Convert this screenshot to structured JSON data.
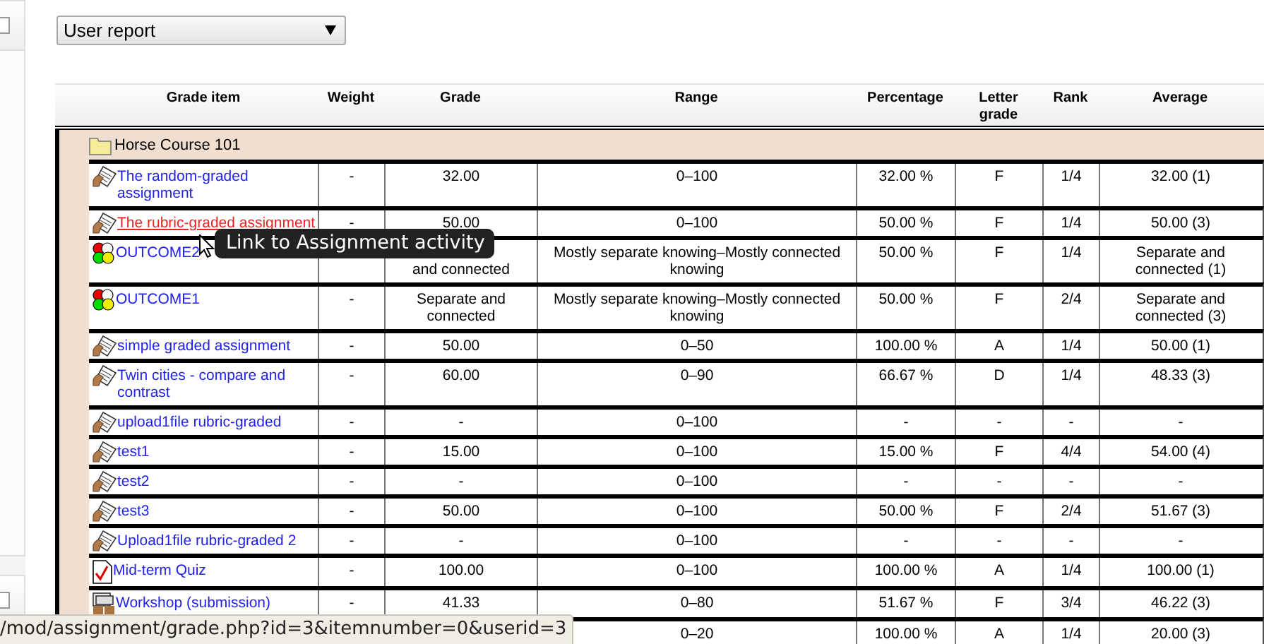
{
  "report_select": {
    "value": "User report"
  },
  "table": {
    "columns": [
      "Grade item",
      "Weight",
      "Grade",
      "Range",
      "Percentage",
      "Letter grade",
      "Rank",
      "Average"
    ],
    "category": {
      "kind": "folder",
      "name": "Horse Course 101"
    },
    "rows": [
      {
        "kind": "assignment",
        "item": "The random-graded assignment",
        "hovered": false,
        "weight": "-",
        "grade": "32.00",
        "range": "0–100",
        "percentage": "32.00 %",
        "letter": "F",
        "rank": "1/4",
        "average": "32.00 (1)"
      },
      {
        "kind": "assignment",
        "item": "The rubric-graded assignment",
        "hovered": true,
        "weight": "-",
        "grade": "50.00",
        "range": "0–100",
        "percentage": "50.00 %",
        "letter": "F",
        "rank": "1/4",
        "average": "50.00 (3)"
      },
      {
        "kind": "outcome",
        "item": "OUTCOME2",
        "hovered": false,
        "grade": "and connected",
        "range": "Mostly separate knowing–Mostly connected knowing",
        "percentage": "50.00 %",
        "letter": "F",
        "rank": "1/4",
        "average": "Separate and connected (1)"
      },
      {
        "kind": "outcome",
        "item": "OUTCOME1",
        "hovered": false,
        "weight": "-",
        "grade": "Separate and connected",
        "range": "Mostly separate knowing–Mostly connected knowing",
        "percentage": "50.00 %",
        "letter": "F",
        "rank": "2/4",
        "average": "Separate and connected (3)"
      },
      {
        "kind": "assignment",
        "item": "simple graded assignment",
        "hovered": false,
        "weight": "-",
        "grade": "50.00",
        "range": "0–50",
        "percentage": "100.00 %",
        "letter": "A",
        "rank": "1/4",
        "average": "50.00 (1)"
      },
      {
        "kind": "assignment",
        "item": "Twin cities - compare and contrast",
        "hovered": false,
        "weight": "-",
        "grade": "60.00",
        "range": "0–90",
        "percentage": "66.67 %",
        "letter": "D",
        "rank": "1/4",
        "average": "48.33 (3)"
      },
      {
        "kind": "assignment",
        "item": "upload1file rubric-graded",
        "hovered": false,
        "weight": "-",
        "grade": "-",
        "range": "0–100",
        "percentage": "-",
        "letter": "-",
        "rank": "-",
        "average": "-"
      },
      {
        "kind": "assignment",
        "item": "test1",
        "hovered": false,
        "weight": "-",
        "grade": "15.00",
        "range": "0–100",
        "percentage": "15.00 %",
        "letter": "F",
        "rank": "4/4",
        "average": "54.00 (4)"
      },
      {
        "kind": "assignment",
        "item": "test2",
        "hovered": false,
        "weight": "-",
        "grade": "-",
        "range": "0–100",
        "percentage": "-",
        "letter": "-",
        "rank": "-",
        "average": "-"
      },
      {
        "kind": "assignment",
        "item": "test3",
        "hovered": false,
        "weight": "-",
        "grade": "50.00",
        "range": "0–100",
        "percentage": "50.00 %",
        "letter": "F",
        "rank": "2/4",
        "average": "51.67 (3)"
      },
      {
        "kind": "assignment",
        "item": "Upload1file rubric-graded 2",
        "hovered": false,
        "weight": "-",
        "grade": "-",
        "range": "0–100",
        "percentage": "-",
        "letter": "-",
        "rank": "-",
        "average": "-"
      },
      {
        "kind": "quiz",
        "item": "Mid-term Quiz",
        "hovered": false,
        "weight": "-",
        "grade": "100.00",
        "range": "0–100",
        "percentage": "100.00 %",
        "letter": "A",
        "rank": "1/4",
        "average": "100.00 (1)"
      },
      {
        "kind": "workshop",
        "item": "Workshop (submission)",
        "hovered": false,
        "weight": "-",
        "grade": "41.33",
        "range": "0–80",
        "percentage": "51.67 %",
        "letter": "F",
        "rank": "3/4",
        "average": "46.22 (3)"
      },
      {
        "range": "0–20",
        "percentage": "100.00 %",
        "letter": "A",
        "rank": "1/4",
        "average": "20.00 (3)"
      }
    ]
  },
  "tooltip": {
    "text": "Link to Assignment activity"
  },
  "status_bar": {
    "text": "/mod/assignment/grade.php?id=3&itemnumber=0&userid=3"
  }
}
